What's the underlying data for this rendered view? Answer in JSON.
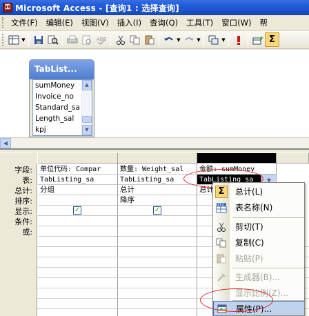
{
  "window": {
    "title": "Microsoft Access - [查询1 : 选择查询]",
    "app_icon": "key-icon"
  },
  "menubar": {
    "items": [
      "文件(F)",
      "编辑(E)",
      "视图(V)",
      "插入(I)",
      "查询(Q)",
      "工具(T)",
      "窗口(W)",
      "帮"
    ]
  },
  "toolbar": {
    "buttons": [
      "view",
      "save",
      "print-preview",
      "print",
      "spelling",
      "cut",
      "copy",
      "paste",
      "undo",
      "redo",
      "query-type",
      "run",
      "show-table",
      "totals"
    ]
  },
  "table_box": {
    "title": "TabList...",
    "fields": [
      "sumMoney",
      "Invoice_no",
      "Standard_sa",
      "Length_sal",
      "kpj"
    ]
  },
  "grid": {
    "row_labels": [
      "字段:",
      "表:",
      "总计:",
      "排序:",
      "显示:",
      "条件:",
      "或:"
    ],
    "columns": [
      {
        "field": "单位代码: Compar",
        "table": "TabListing_sa",
        "total": "分组",
        "sort": "",
        "show": true
      },
      {
        "field": "数量: Weight_sal",
        "table": "TabListing_sa",
        "total": "总计",
        "sort": "降序",
        "show": true
      },
      {
        "field": "金额: sumMoney",
        "table": "TabListing_sa",
        "total": "总计",
        "sort": "",
        "show": false
      }
    ]
  },
  "context_menu": {
    "items": [
      {
        "label": "总计(L)",
        "icon": "sigma-icon",
        "disabled": false
      },
      {
        "label": "表名称(N)",
        "icon": "table-name-icon",
        "disabled": false
      },
      {
        "label": "剪切(T)",
        "icon": "scissors-icon",
        "disabled": false
      },
      {
        "label": "复制(C)",
        "icon": "copy-icon",
        "disabled": false
      },
      {
        "label": "粘贴(P)",
        "icon": "paste-icon",
        "disabled": true
      },
      {
        "label": "生成器(B)...",
        "icon": "builder-icon",
        "disabled": true
      },
      {
        "label": "显示比例(Z)...",
        "icon": "zoom-icon",
        "disabled": true
      },
      {
        "label": "属性(P)...",
        "icon": "properties-icon",
        "disabled": false
      }
    ]
  },
  "colors": {
    "titlebar": "#245edb",
    "menu_highlight": "#c1d2ee",
    "annotation": "#e02020"
  }
}
